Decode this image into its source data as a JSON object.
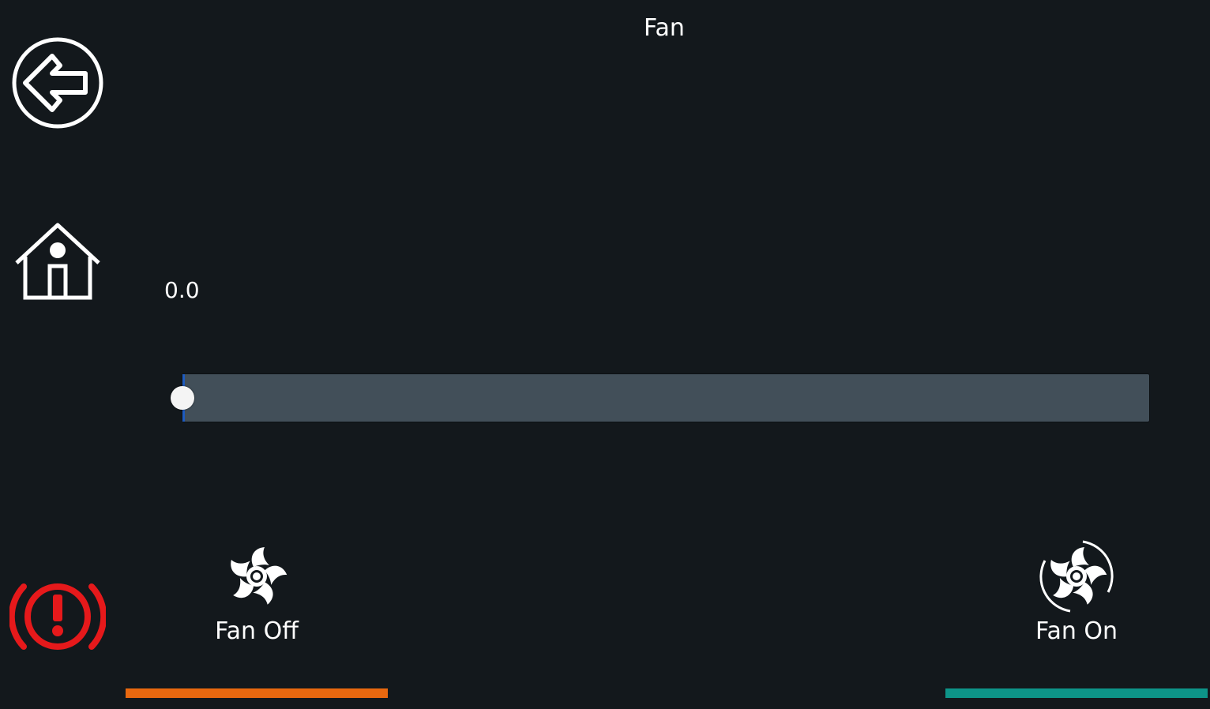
{
  "header": {
    "title": "Fan"
  },
  "sidebar": {
    "back": {
      "icon": "back-arrow-icon"
    },
    "home": {
      "icon": "home-icon"
    },
    "emergency_stop": {
      "icon": "emergency-stop-icon",
      "color": "#e6191b"
    }
  },
  "fan_speed": {
    "value_text": "0.0",
    "value": 0.0,
    "min": 0,
    "max": 100
  },
  "actions": {
    "fan_off": {
      "label": "Fan Off",
      "icon": "fan-icon",
      "accent": "#e8680f"
    },
    "fan_on": {
      "label": "Fan On",
      "icon": "fan-spinning-icon",
      "accent": "#0d9488"
    }
  },
  "colors": {
    "background": "#13181c",
    "slider_track": "#424f59",
    "slider_fill": "#1e5bbf",
    "text": "#ffffff"
  }
}
